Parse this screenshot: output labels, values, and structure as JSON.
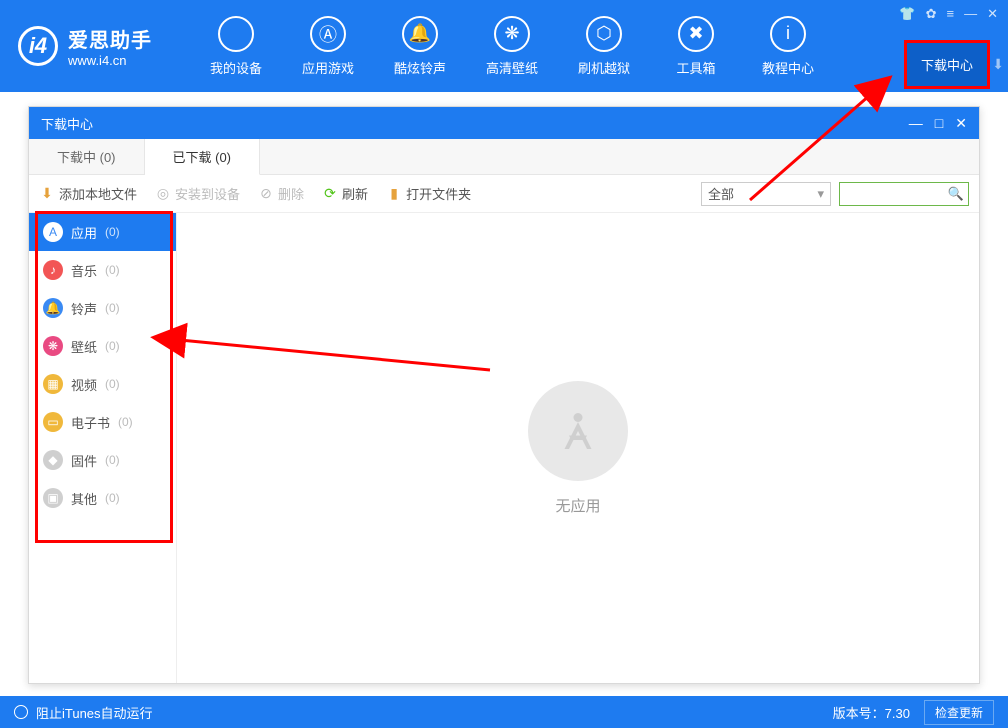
{
  "header": {
    "app_name": "爱思助手",
    "app_url": "www.i4.cn",
    "nav": [
      {
        "label": "我的设备",
        "icon": ""
      },
      {
        "label": "应用游戏",
        "icon": "Ⓐ"
      },
      {
        "label": "酷炫铃声",
        "icon": "🔔"
      },
      {
        "label": "高清壁纸",
        "icon": "❋"
      },
      {
        "label": "刷机越狱",
        "icon": "⬡"
      },
      {
        "label": "工具箱",
        "icon": "✖"
      },
      {
        "label": "教程中心",
        "icon": "i"
      }
    ],
    "download_center": "下载中心"
  },
  "panel": {
    "title": "下载中心",
    "tabs": [
      {
        "label": "下载中  (0)",
        "active": false
      },
      {
        "label": "已下载  (0)",
        "active": true
      }
    ],
    "toolbar": {
      "add_local": "添加本地文件",
      "install": "安装到设备",
      "delete": "删除",
      "refresh": "刷新",
      "open_folder": "打开文件夹",
      "filter_selected": "全部"
    },
    "sidebar": [
      {
        "label": "应用",
        "count": "(0)",
        "color": "#3a8af3",
        "active": true,
        "ico": "A"
      },
      {
        "label": "音乐",
        "count": "(0)",
        "color": "#f25555",
        "ico": "♪"
      },
      {
        "label": "铃声",
        "count": "(0)",
        "color": "#3a8af3",
        "ico": "🔔"
      },
      {
        "label": "壁纸",
        "count": "(0)",
        "color": "#e94a82",
        "ico": "❋"
      },
      {
        "label": "视频",
        "count": "(0)",
        "color": "#f0b83b",
        "ico": "▦"
      },
      {
        "label": "电子书",
        "count": "(0)",
        "color": "#f0b83b",
        "ico": "▭"
      },
      {
        "label": "固件",
        "count": "(0)",
        "color": "#cfcfcf",
        "ico": "◆"
      },
      {
        "label": "其他",
        "count": "(0)",
        "color": "#cfcfcf",
        "ico": "▣"
      }
    ],
    "empty_text": "无应用"
  },
  "status": {
    "left": "阻止iTunes自动运行",
    "version_label": "版本号：7.30",
    "check_update": "检查更新"
  }
}
